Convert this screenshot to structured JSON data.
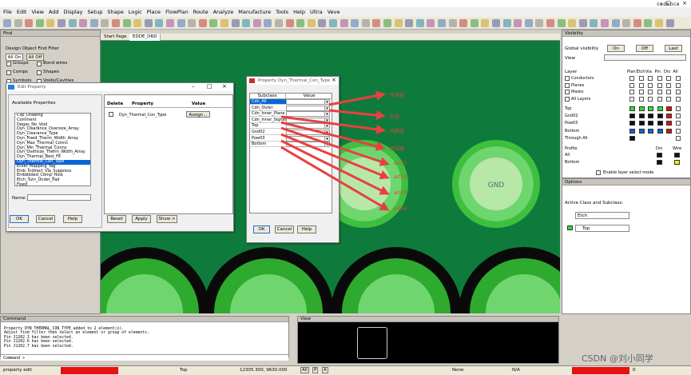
{
  "app": {
    "brand": "cadence"
  },
  "menu": [
    "File",
    "Edit",
    "View",
    "Add",
    "Display",
    "Setup",
    "Shape",
    "Logic",
    "Place",
    "FlowPlan",
    "Route",
    "Analyze",
    "Manufacture",
    "Tools",
    "Help",
    "Ultra",
    "Veve"
  ],
  "find": {
    "title": "Find",
    "filter_label": "Design Object Find Filter",
    "all_on": "All On",
    "all_off": "All Off",
    "items": [
      {
        "label": "Groups",
        "label2": "Bond wires"
      },
      {
        "label": "Comps",
        "label2": "Shapes"
      },
      {
        "label": "Symbols",
        "label2": "Voids/Cavities"
      }
    ]
  },
  "tabs": [
    "Start Page",
    "EDDE_DRD"
  ],
  "edit_property": {
    "title": "Edit Property",
    "available_label": "Available Properties",
    "list": [
      "Clip_Drawing",
      "Comment",
      "Degas_No_Void",
      "Dyn_Clearance_Oversize_Array",
      "Dyn_Clearance_Type",
      "Dyn_Fixed_Therm_Width_Array",
      "Dyn_Max_Thermal_Conns",
      "Dyn_Min_Thermal_Conns",
      "Dyn_Oversize_Therm_Width_Array",
      "Dyn_Thermal_Best_Fit",
      "Dyn_Thermal_Con_Type",
      "Ecset_Mapping_Tag",
      "Emb_Indirect_Via_Suppress",
      "Embedded_Comp_Hole",
      "Etch_Turn_Under_Pad",
      "Fixed"
    ],
    "selected_index": 10,
    "name_label": "Name:",
    "col_delete": "Delete",
    "col_property": "Property",
    "col_value": "Value",
    "row_property": "Dyn_Thermal_Con_Type",
    "row_value": "Assign...",
    "ok": "OK",
    "cancel": "Cancel",
    "help": "Help",
    "reset": "Reset",
    "apply": "Apply",
    "show": "Show >"
  },
  "prop_dialog": {
    "title": "Property Dyn_Thermal_Con_Type",
    "col_subclass": "Subclass",
    "col_value": "Value",
    "rows": [
      "Cdn_All",
      "Cdn_Outer",
      "Cdn_Inner_Plane",
      "Cdn_Inner_Signal",
      "Top",
      "Gnd02",
      "Pow03",
      "Bottom"
    ],
    "ok": "OK",
    "cancel": "Cancel",
    "help": "Help"
  },
  "annotations": [
    "所有层",
    "外层",
    "内面层",
    "走线层",
    "art01",
    "art02",
    "art03",
    "art04"
  ],
  "pads": {
    "gnd_label": "GND"
  },
  "visibility": {
    "title": "Visibility",
    "global": "Global visibility",
    "on": "On",
    "off": "Off",
    "last": "Last",
    "view": "View",
    "layer_hdr": "Layer",
    "cols": [
      "Plan",
      "Etch",
      "Via",
      "Pin",
      "Drc",
      "All"
    ],
    "groups": [
      "Conductors",
      "Planes",
      "Masks",
      "All Layers"
    ],
    "layers": [
      "Top",
      "Gnd02",
      "Pow03",
      "Bottom",
      "Through All"
    ],
    "profile_hdr": "Profile",
    "drc": "Drc",
    "wire": "Wire",
    "profile_rows": [
      "All",
      "Bottom"
    ],
    "enable_layer": "Enable layer select mode"
  },
  "options": {
    "title": "Options",
    "active_label": "Active Class and Subclass:",
    "class_value": "Etch",
    "subclass_value": "Top"
  },
  "command": {
    "title": "Command",
    "lines": [
      "Property DYN_THERMAL_CON_TYPE added to 2 element(s).",
      "Adjust find filter then select an element or group of elements.",
      "Pin J1202.3  has been selected.",
      "Pin J1202.6  has been selected.",
      "Pin J1202.7  has been selected."
    ],
    "prompt": "Command >"
  },
  "viewpane": {
    "title": "View"
  },
  "status": {
    "mode": "property edit",
    "layer": "Top",
    "coords": "12305.300, 9630.000",
    "unit1": "All",
    "unit2": "P",
    "unit3": "A",
    "none": "None",
    "na": "N/A",
    "zero": "0"
  },
  "watermark": "CSDN @刘小同学",
  "colors": {
    "canvas": "#0e7b3c",
    "pad_outer": "#6fd66f",
    "pad_mid": "#2faa2f",
    "arrow": "#e84040",
    "selection": "#0a64d8",
    "swatch_green": "#2ee02e",
    "swatch_red": "#e01010",
    "swatch_blue": "#1060e0",
    "swatch_yellow": "#f0f000"
  }
}
